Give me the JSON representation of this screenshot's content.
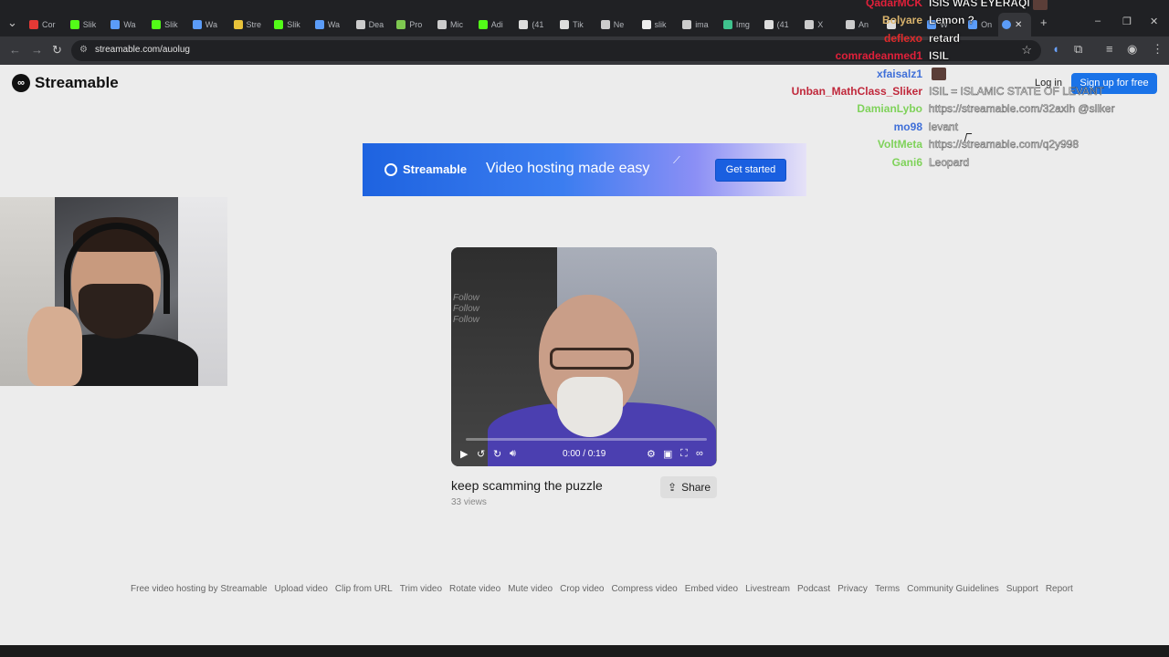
{
  "browser": {
    "tabs": [
      {
        "label": "Cor",
        "icon": "youtube-icon",
        "color": "#e53935"
      },
      {
        "label": "Slik",
        "icon": "kick-icon",
        "color": "#53fc18"
      },
      {
        "label": "Wa",
        "icon": "streamable-icon",
        "color": "#5b9cf8"
      },
      {
        "label": "Slik",
        "icon": "kick-icon",
        "color": "#53fc18"
      },
      {
        "label": "Wa",
        "icon": "streamable-icon",
        "color": "#5b9cf8"
      },
      {
        "label": "Stre",
        "icon": "chart-icon",
        "color": "#e8c33a"
      },
      {
        "label": "Slik",
        "icon": "kick-icon",
        "color": "#53fc18"
      },
      {
        "label": "Wa",
        "icon": "streamable-icon",
        "color": "#5b9cf8"
      },
      {
        "label": "Dea",
        "icon": "x-icon",
        "color": "#cccccc"
      },
      {
        "label": "Pro",
        "icon": "spark-icon",
        "color": "#7ec850"
      },
      {
        "label": "Mic",
        "icon": "x-icon",
        "color": "#cccccc"
      },
      {
        "label": "Adi",
        "icon": "kick-icon",
        "color": "#53fc18"
      },
      {
        "label": "(41",
        "icon": "tiktok-icon",
        "color": "#dddddd"
      },
      {
        "label": "Tik",
        "icon": "tiktok-icon",
        "color": "#dddddd"
      },
      {
        "label": "Ne",
        "icon": "globe-icon",
        "color": "#cccccc"
      },
      {
        "label": "slik",
        "icon": "diamond-icon",
        "color": "#eeeeee"
      },
      {
        "label": "ima",
        "icon": "globe-icon",
        "color": "#cccccc"
      },
      {
        "label": "Img",
        "icon": "image-icon",
        "color": "#3fc28d"
      },
      {
        "label": "(41",
        "icon": "tiktok-icon",
        "color": "#dddddd"
      },
      {
        "label": "X",
        "icon": "x-icon",
        "color": "#cccccc"
      },
      {
        "label": "An",
        "icon": "x-icon",
        "color": "#cccccc"
      },
      {
        "label": "",
        "icon": "tiktok-icon",
        "color": "#dddddd"
      },
      {
        "label": "W",
        "icon": "streamable-icon",
        "color": "#5b9cf8"
      },
      {
        "label": "On",
        "icon": "streamable-icon",
        "color": "#5b9cf8"
      }
    ],
    "active_tab_icon": "streamable-icon",
    "url": "streamable.com/auolug",
    "new_tab_symbol": "+",
    "window_controls": [
      "–",
      "❐",
      "✕"
    ]
  },
  "site": {
    "logo_text": "Streamable",
    "login_label": "Log in",
    "signup_label": "Sign up for free"
  },
  "banner": {
    "logo_text": "Streamable",
    "tagline": "Video hosting made easy",
    "cta_label": "Get started"
  },
  "video": {
    "title": "keep scamming the puzzle",
    "views": "33 views",
    "time": "0:00 / 0:19",
    "progress_fraction": 0.0,
    "share_label": "Share",
    "sign_text": "Follow\nFollow\nFollow"
  },
  "footer": {
    "links": [
      "Free video hosting by Streamable",
      "Upload video",
      "Clip from URL",
      "Trim video",
      "Rotate video",
      "Mute video",
      "Crop video",
      "Compress video",
      "Embed video",
      "Livestream",
      "Podcast",
      "Privacy",
      "Terms",
      "Community Guidelines",
      "Support",
      "Report"
    ]
  },
  "chat": {
    "lines": [
      {
        "user": "QadarMCK",
        "color": "#e0203a",
        "msg": "ISIS WAS EYERAQI",
        "faint": false,
        "emote": true
      },
      {
        "user": "Bolyare",
        "color": "#d9b36c",
        "msg": "Lemon ?",
        "faint": false,
        "emote": false
      },
      {
        "user": "deflexo",
        "color": "#e02a2a",
        "msg": "retard",
        "faint": false,
        "emote": false
      },
      {
        "user": "comradeanmed1",
        "color": "#e0203a",
        "msg": "ISIL",
        "faint": false,
        "emote": false
      },
      {
        "user": "xfaisalz1",
        "color": "#3f6fd8",
        "msg": "",
        "faint": false,
        "emote": true
      },
      {
        "user": "Unban_MathClass_Sliker",
        "color": "#c0283b",
        "msg": "ISIL = ISLAMIC STATE OF LEVANT",
        "faint": true,
        "emote": false
      },
      {
        "user": "DamianLybo",
        "color": "#7fd25a",
        "msg": "https://streamable.com/32axlh @sliker",
        "faint": true,
        "emote": false
      },
      {
        "user": "mo98",
        "color": "#3f6fd8",
        "msg": "levant",
        "faint": true,
        "emote": false
      },
      {
        "user": "VoltMeta",
        "color": "#7fd25a",
        "msg": "https://streamable.com/q2y998",
        "faint": true,
        "emote": false
      },
      {
        "user": "Gani6",
        "color": "#7fd25a",
        "msg": "Leopard",
        "faint": true,
        "emote": false
      }
    ]
  }
}
